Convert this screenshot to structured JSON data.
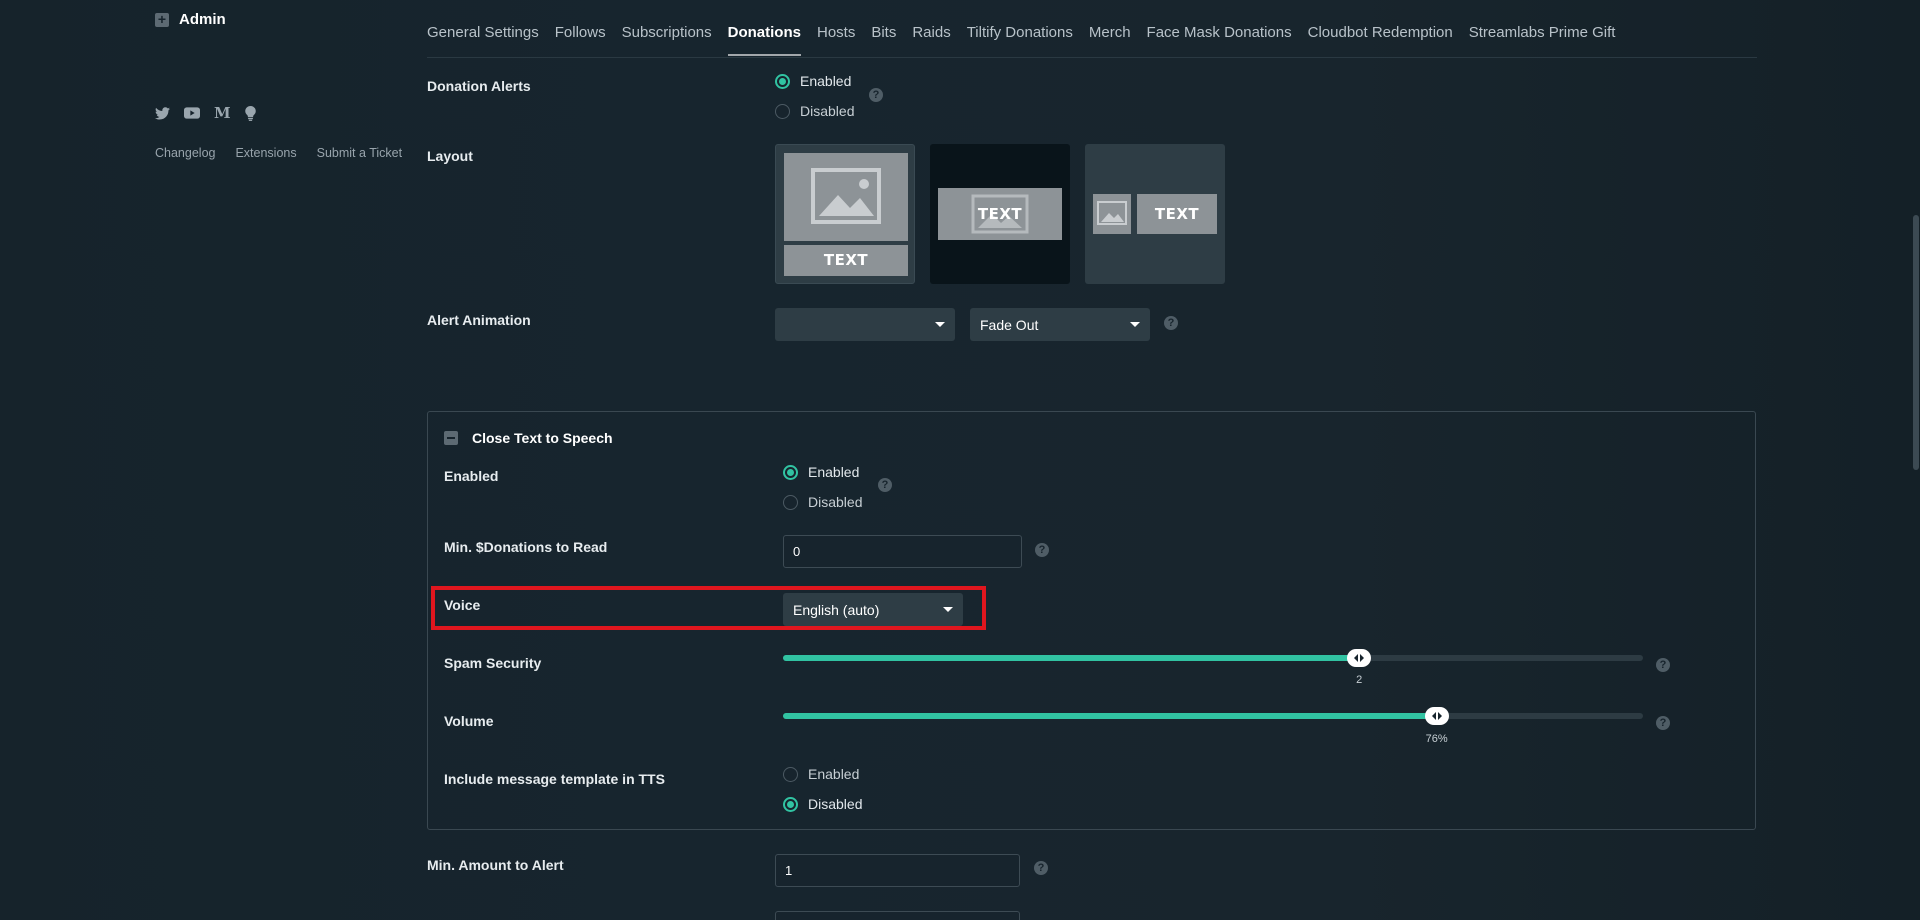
{
  "sidebar": {
    "admin_label": "Admin",
    "social_icons": [
      "twitter-icon",
      "youtube-icon",
      "medium-icon",
      "lightbulb-icon"
    ],
    "medium_glyph": "M",
    "footer_links": [
      "Changelog",
      "Extensions",
      "Submit a Ticket"
    ]
  },
  "tabs": {
    "items": [
      "General Settings",
      "Follows",
      "Subscriptions",
      "Donations",
      "Hosts",
      "Bits",
      "Raids",
      "Tiltify Donations",
      "Merch",
      "Face Mask Donations",
      "Cloudbot Redemption",
      "Streamlabs Prime Gift"
    ],
    "active": "Donations"
  },
  "donation_alerts": {
    "label": "Donation Alerts",
    "options": [
      "Enabled",
      "Disabled"
    ],
    "selected": "Enabled"
  },
  "layout": {
    "label": "Layout",
    "card_text": "TEXT"
  },
  "alert_animation": {
    "label": "Alert Animation",
    "in_value": "",
    "out_value": "Fade Out"
  },
  "tts": {
    "title": "Close Text to Speech",
    "enabled": {
      "label": "Enabled",
      "options": [
        "Enabled",
        "Disabled"
      ],
      "selected": "Enabled"
    },
    "min_donations": {
      "label": "Min. $Donations to Read",
      "value": "0"
    },
    "voice": {
      "label": "Voice",
      "value": "English (auto)"
    },
    "spam_security": {
      "label": "Spam Security",
      "value_text": "2",
      "fraction": 0.67
    },
    "volume": {
      "label": "Volume",
      "value_text": "76%",
      "fraction": 0.76
    },
    "include_template": {
      "label": "Include message template in TTS",
      "options": [
        "Enabled",
        "Disabled"
      ],
      "selected": "Disabled"
    }
  },
  "min_amount_alert": {
    "label": "Min. Amount to Alert",
    "value": "1"
  },
  "colors": {
    "accent": "#31c3a2",
    "highlight": "#e0161e",
    "background": "#17242d"
  }
}
